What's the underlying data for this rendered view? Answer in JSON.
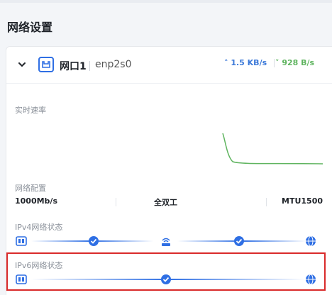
{
  "page": {
    "title": "网络设置"
  },
  "port": {
    "name": "网口1",
    "device": "enp2s0"
  },
  "traffic": {
    "label": "实时速率",
    "upload": "1.5 KB/s",
    "download": "928 B/s"
  },
  "config": {
    "label": "网络配置",
    "speed": "1000Mb/s",
    "duplex": "全双工",
    "mtu": "MTU1500"
  },
  "ipv4": {
    "label": "IPv4网络状态"
  },
  "ipv6": {
    "label": "IPv6网络状态"
  },
  "colors": {
    "accent": "#2f6fe4",
    "upload": "#3a78d8",
    "download": "#5fb45f",
    "highlight": "#d92a2a"
  }
}
